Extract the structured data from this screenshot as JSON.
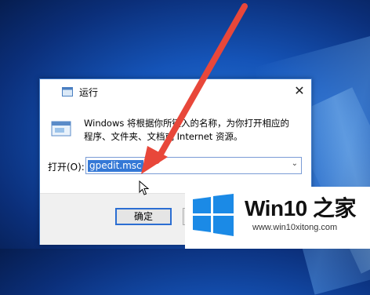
{
  "dialog": {
    "title": "运行",
    "close_glyph": "✕",
    "description": "Windows 将根据你所键入的名称，为你打开相应的程序、文件夹、文档或 Internet 资源。",
    "open_label": "打开(O):",
    "command_value": "gpedit.msc",
    "dropdown_glyph": "⌄",
    "ok_label": "确定"
  },
  "watermark": {
    "brand": "Win10 之家",
    "url": "www.win10xitong.com"
  },
  "colors": {
    "arrow": "#e8473a",
    "selection": "#3478d6",
    "logo_blue": "#1b8ae6"
  },
  "icons": [
    "run-app-icon",
    "close-icon",
    "chevron-down-icon",
    "cursor-icon",
    "windows-logo-icon"
  ]
}
